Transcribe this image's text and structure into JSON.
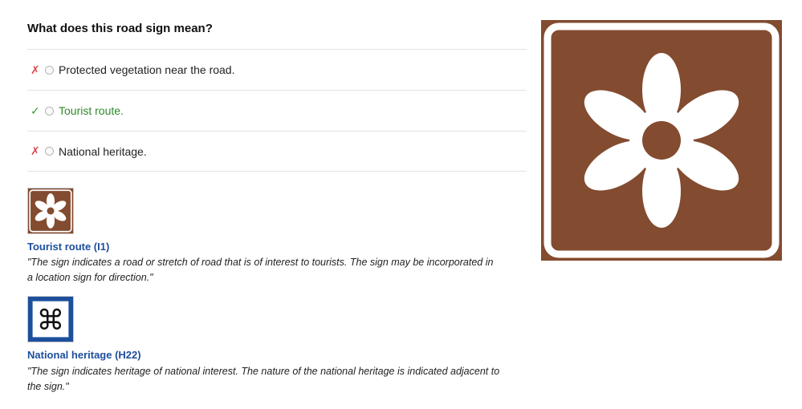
{
  "question": "What does this road sign mean?",
  "options": [
    {
      "label": "Protected vegetation near the road.",
      "status": "wrong",
      "mark": "✗"
    },
    {
      "label": "Tourist route.",
      "status": "correct",
      "mark": "✓"
    },
    {
      "label": "National heritage.",
      "status": "wrong",
      "mark": "✗"
    }
  ],
  "explanations": [
    {
      "title": "Tourist route (I1)",
      "description": "\"The sign indicates a road or stretch of road that is of interest to tourists. The sign may be incorporated in a location sign for direction.\"",
      "icon": "flower-icon"
    },
    {
      "title": "National heritage (H22)",
      "description": "\"The sign indicates heritage of national interest. The nature of the national heritage is indicated adjacent to the sign.\"",
      "icon": "heritage-knot-icon"
    }
  ],
  "colors": {
    "brown": "#834b2f",
    "blue": "#1c4f9c",
    "correct": "#2e8a2b",
    "wrong": "#e0474c"
  }
}
